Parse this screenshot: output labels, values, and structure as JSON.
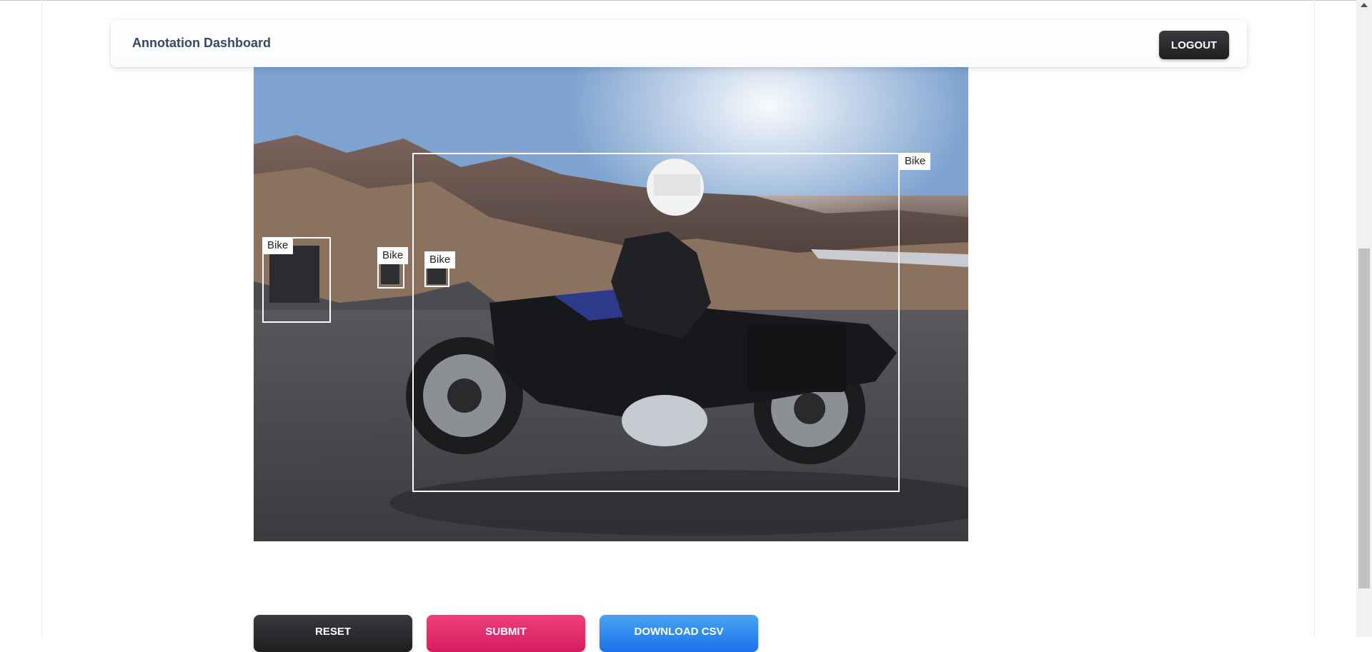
{
  "navbar": {
    "title": "Annotation Dashboard",
    "logout_label": "LOGOUT"
  },
  "annotations": [
    {
      "label": "Bike"
    },
    {
      "label": "Bike"
    },
    {
      "label": "Bike"
    },
    {
      "label": "Bike"
    }
  ],
  "actions": {
    "reset_label": "RESET",
    "submit_label": "SUBMIT",
    "download_label": "DOWNLOAD CSV"
  },
  "colors": {
    "dark": "#2b2b2f",
    "pink": "#e91e63",
    "blue": "#1a73e8",
    "bbox": "#ffffff"
  }
}
